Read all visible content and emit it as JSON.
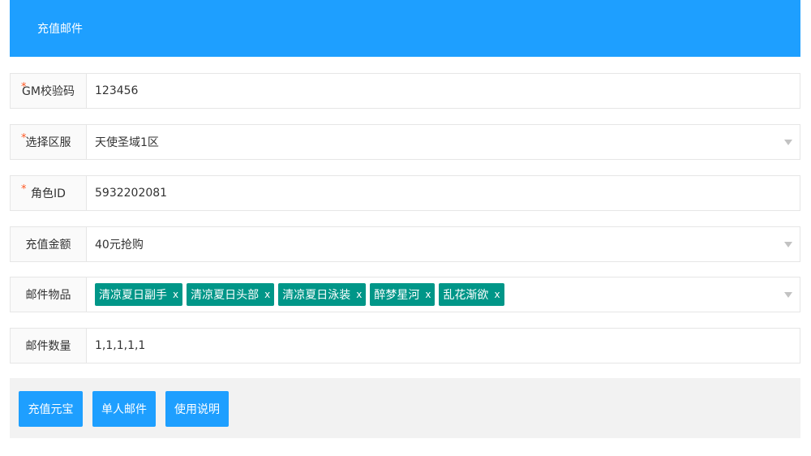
{
  "header": {
    "title": "充值邮件"
  },
  "form": {
    "gm_code": {
      "label": "GM校验码",
      "required_mark": "*",
      "value": "123456"
    },
    "server": {
      "label": "选择区服",
      "required_mark": "*",
      "value": "天使圣域1区"
    },
    "role_id": {
      "label": "角色ID",
      "required_mark": "*",
      "value": "5932202081"
    },
    "amount": {
      "label": "充值金额",
      "value": "40元抢购"
    },
    "items": {
      "label": "邮件物品",
      "tags": [
        {
          "text": "清凉夏日副手",
          "close": "x"
        },
        {
          "text": "清凉夏日头部",
          "close": "x"
        },
        {
          "text": "清凉夏日泳装",
          "close": "x"
        },
        {
          "text": "醉梦星河",
          "close": "x"
        },
        {
          "text": "乱花渐欲",
          "close": "x"
        }
      ]
    },
    "quantity": {
      "label": "邮件数量",
      "value": "1,1,1,1,1"
    }
  },
  "buttons": {
    "recharge": "充值元宝",
    "single_mail": "单人邮件",
    "instructions": "使用说明"
  },
  "colors": {
    "primary": "#1e9fff",
    "tag": "#009688",
    "required": "#ff5722"
  },
  "icons": {
    "dropdown": "caret-down-icon",
    "tag_close": "close-icon"
  }
}
